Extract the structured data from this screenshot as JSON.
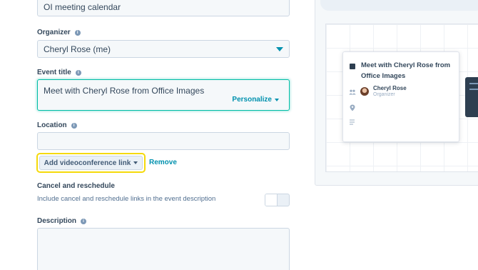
{
  "form": {
    "meeting_name_value": "OI meeting calendar",
    "organizer": {
      "label": "Organizer",
      "value": "Cheryl Rose (me)"
    },
    "event_title": {
      "label": "Event title",
      "value": "Meet with Cheryl Rose from Office Images",
      "personalize_label": "Personalize"
    },
    "location": {
      "label": "Location",
      "value": ""
    },
    "videoconference": {
      "button_label": "Add videoconference link",
      "remove_label": "Remove"
    },
    "cancel_reschedule": {
      "heading": "Cancel and reschedule",
      "description": "Include cancel and reschedule links in the event description",
      "toggle_on": false
    },
    "description": {
      "label": "Description",
      "value": ""
    }
  },
  "preview": {
    "event_title": "Meet with Cheryl Rose from Office Images",
    "organizer_name": "Cheryl Rose",
    "organizer_role": "Organizer"
  },
  "colors": {
    "accent": "#0091ae",
    "focus": "#00bda5",
    "highlight": "#f5d90a",
    "event": "#2d3e50"
  },
  "icons": [
    "info-icon",
    "chevron-down-icon",
    "people-icon",
    "location-pin-icon",
    "description-lines-icon"
  ]
}
